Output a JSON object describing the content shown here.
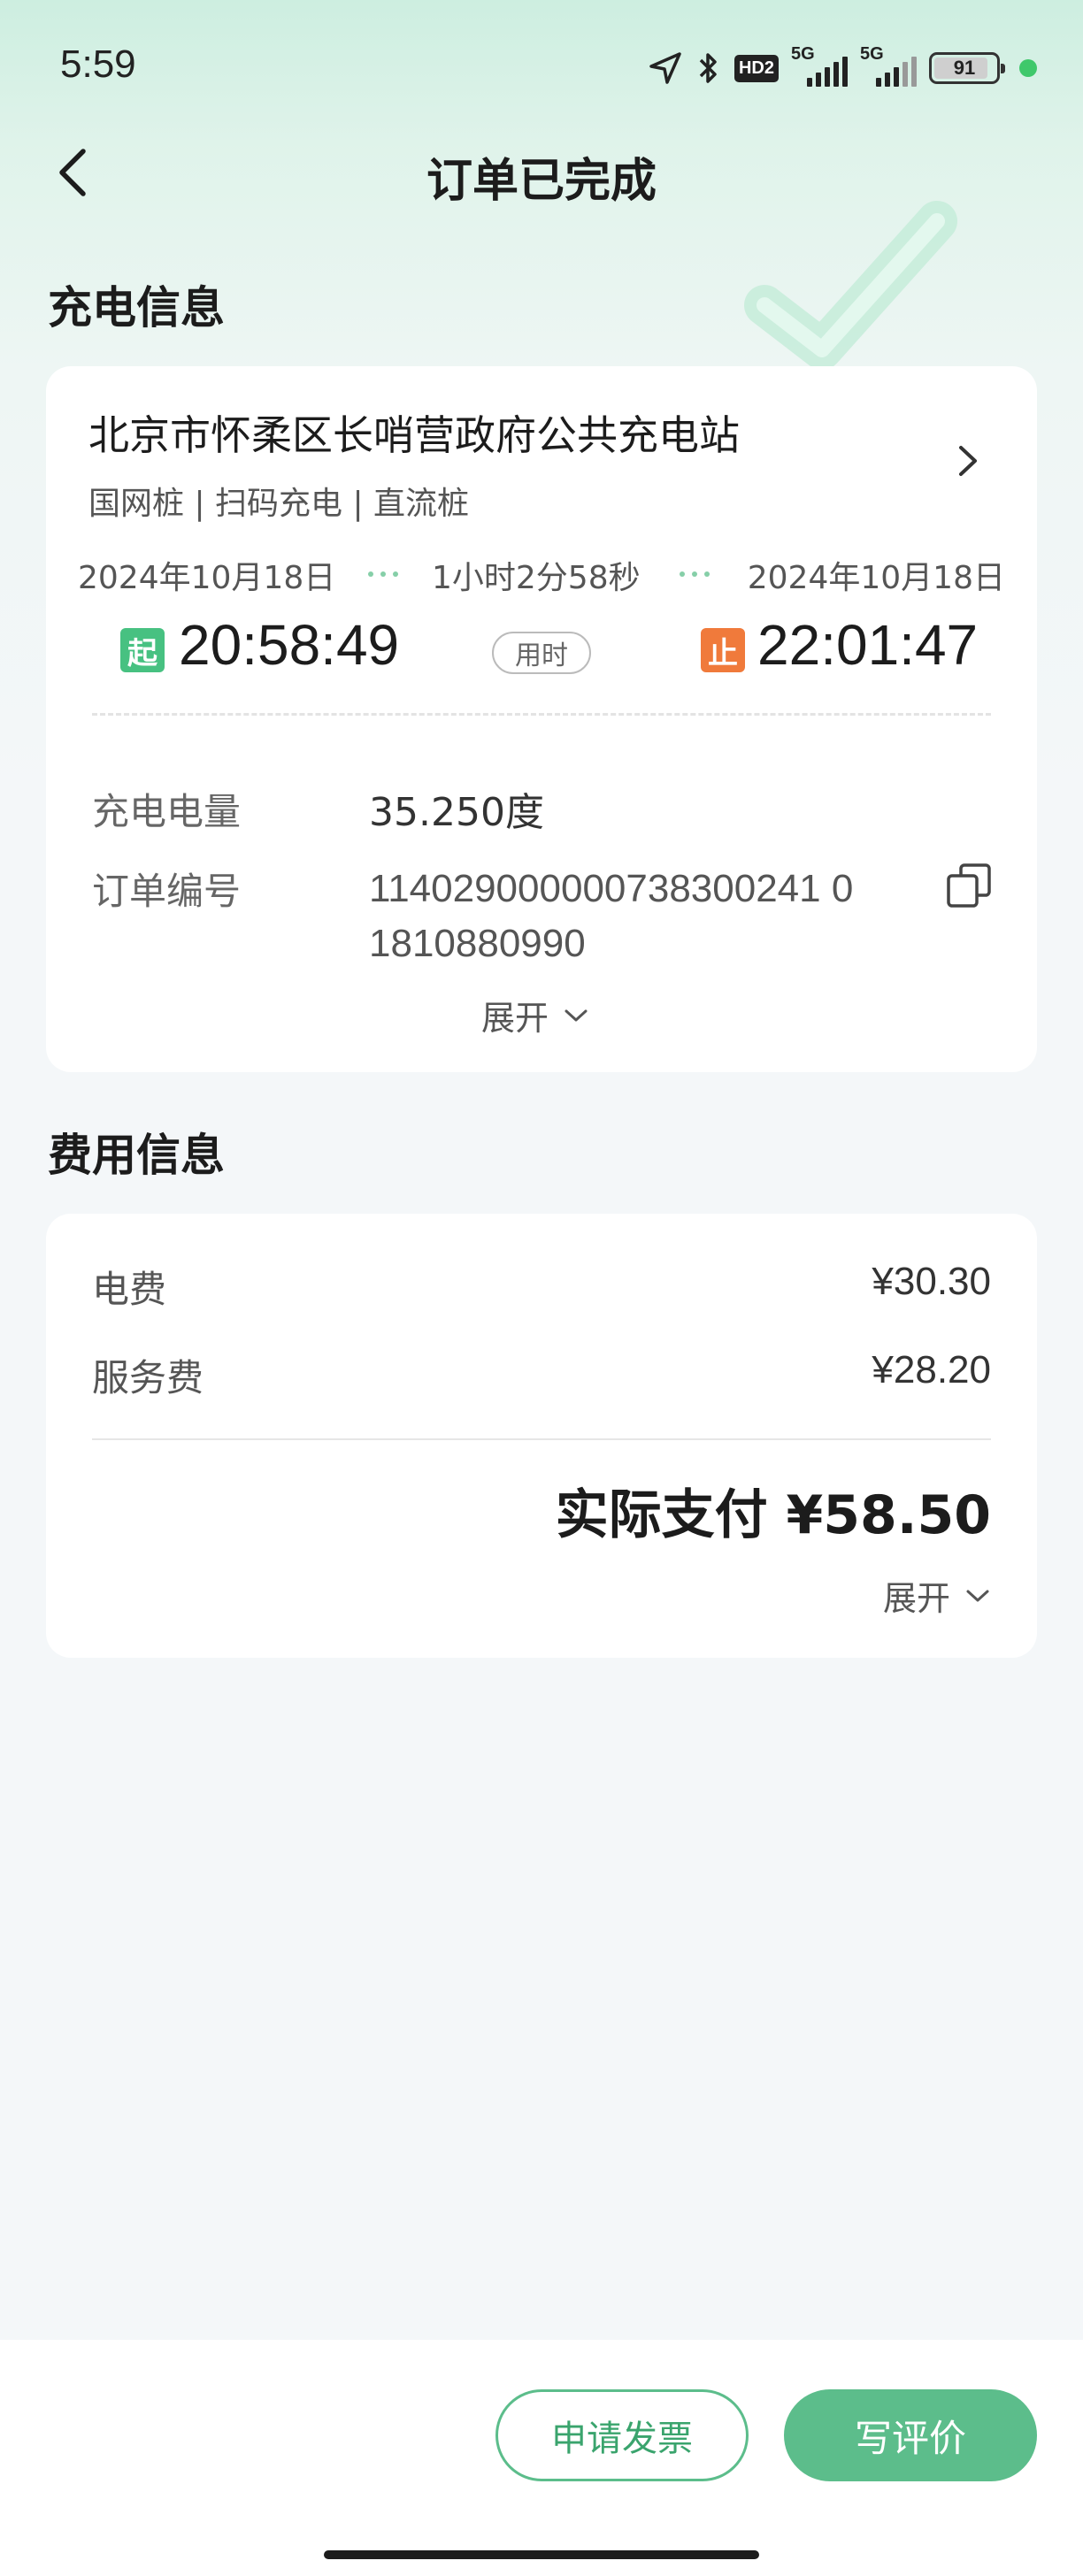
{
  "status_bar": {
    "time": "5:59",
    "hd_badge": "HD2",
    "signal1_label": "5G",
    "signal2_label": "5G",
    "battery_level": "91"
  },
  "nav": {
    "title": "订单已完成"
  },
  "charging_section": {
    "title": "充电信息",
    "station_name": "北京市怀柔区长哨营政府公共充电站",
    "station_tags": "国网桩 | 扫码充电 | 直流桩",
    "start_date": "2024年10月18日",
    "end_date": "2024年10月18日",
    "duration": "1小时2分58秒",
    "start_badge": "起",
    "stop_badge": "止",
    "start_time": "20:58:49",
    "end_time": "22:01:47",
    "usage_tag": "用时",
    "energy_label": "充电电量",
    "energy_value": "35.250度",
    "order_label": "订单编号",
    "order_no": "114029000000738300241 01810880990",
    "expand_label": "展开"
  },
  "fee_section": {
    "title": "费用信息",
    "electricity_label": "电费",
    "electricity_value": "¥30.30",
    "service_label": "服务费",
    "service_value": "¥28.20",
    "total": "实际支付 ¥58.50",
    "expand_label": "展开"
  },
  "bottom_bar": {
    "invoice_button": "申请发票",
    "review_button": "写评价"
  },
  "colors": {
    "accent": "#5cbd8b",
    "start_badge": "#47c181",
    "stop_badge": "#f07a3b"
  }
}
